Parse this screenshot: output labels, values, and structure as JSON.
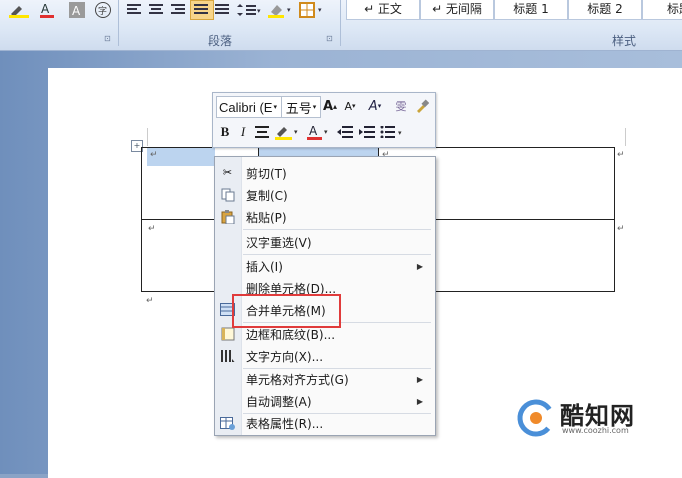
{
  "ribbon": {
    "paragraph_group_label": "段落",
    "styles_group_label": "样式",
    "styles": [
      "↵ 正文",
      "↵ 无间隔",
      "标题 1",
      "标题 2",
      "标题"
    ]
  },
  "mini_toolbar": {
    "font_name": "Calibri (E",
    "font_size": "五号"
  },
  "context_menu": {
    "items": [
      {
        "label": "剪切(T)",
        "icon": "scissors-icon"
      },
      {
        "label": "复制(C)",
        "icon": "copy-icon"
      },
      {
        "label": "粘贴(P)",
        "icon": "paste-icon"
      },
      {
        "label": "汉字重选(V)",
        "icon": ""
      },
      {
        "label": "插入(I)",
        "icon": "",
        "submenu": true
      },
      {
        "label": "删除单元格(D)...",
        "icon": ""
      },
      {
        "label": "合并单元格(M)",
        "icon": "merge-cells-icon",
        "highlighted": true
      },
      {
        "label": "边框和底纹(B)...",
        "icon": "borders-icon"
      },
      {
        "label": "文字方向(X)...",
        "icon": "text-direction-icon"
      },
      {
        "label": "单元格对齐方式(G)",
        "icon": "",
        "submenu": true
      },
      {
        "label": "自动调整(A)",
        "icon": "",
        "submenu": true
      },
      {
        "label": "表格属性(R)...",
        "icon": "table-properties-icon"
      }
    ],
    "highlight_color": "#e03b3b"
  },
  "watermark": {
    "name": "酷知网",
    "url": "www.coozhi.com"
  }
}
